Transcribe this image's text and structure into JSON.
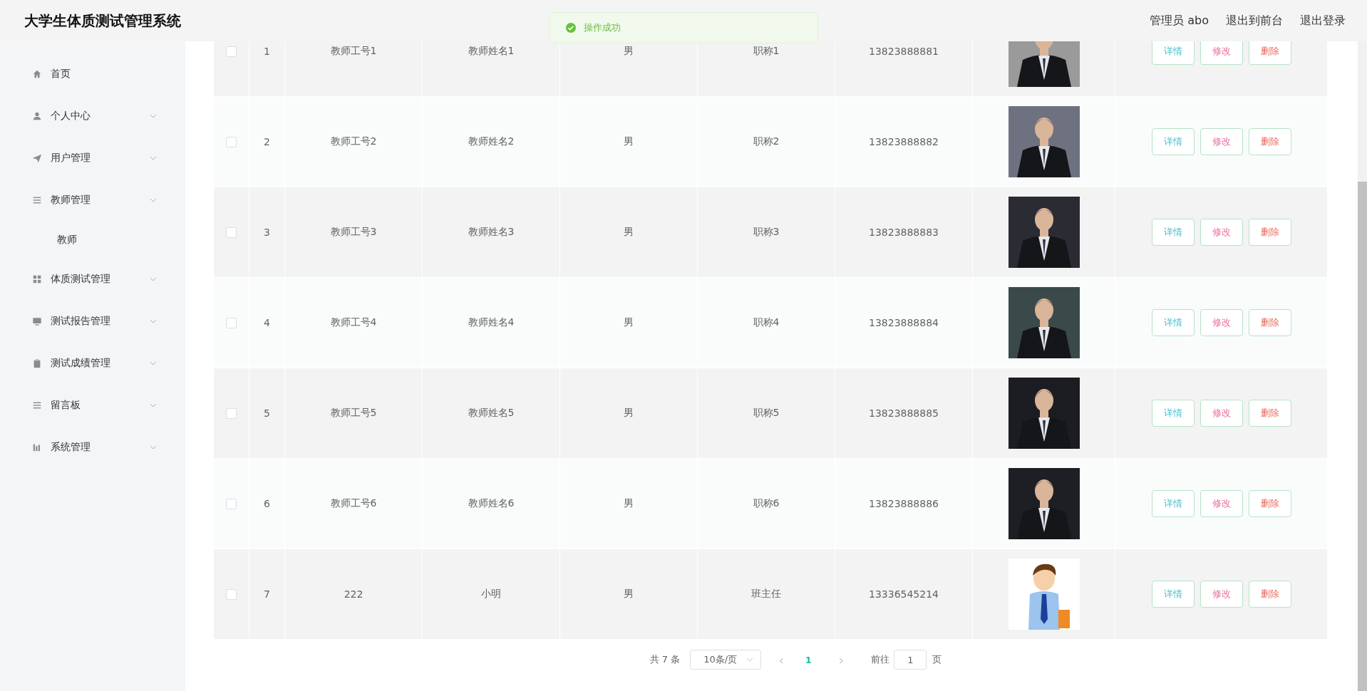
{
  "header": {
    "title": "大学生体质测试管理系统",
    "user": "管理员 abo",
    "links": [
      "退出到前台",
      "退出登录"
    ]
  },
  "toast": {
    "kind": "success",
    "message": "操作成功"
  },
  "sidebar": {
    "items": [
      {
        "label": "首页",
        "submenu": false
      },
      {
        "label": "个人中心",
        "submenu": true
      },
      {
        "label": "用户管理",
        "submenu": true
      },
      {
        "label": "教师管理",
        "submenu": true,
        "children": [
          {
            "label": "教师"
          }
        ]
      },
      {
        "label": "体质测试管理",
        "submenu": true
      },
      {
        "label": "测试报告管理",
        "submenu": true
      },
      {
        "label": "测试成绩管理",
        "submenu": true
      },
      {
        "label": "留言板",
        "submenu": true
      },
      {
        "label": "系统管理",
        "submenu": true
      }
    ]
  },
  "table": {
    "rows": [
      {
        "checked": false,
        "index": "1",
        "teacher_id": "教师工号1",
        "name": "教师姓名1",
        "gender": "男",
        "title": "职称1",
        "phone": "13823888881",
        "actions": [
          {
            "kind": "detail",
            "label": "详情"
          },
          {
            "kind": "edit",
            "label": "修改"
          },
          {
            "kind": "delete",
            "label": "删除"
          }
        ]
      },
      {
        "checked": false,
        "index": "2",
        "teacher_id": "教师工号2",
        "name": "教师姓名2",
        "gender": "男",
        "title": "职称2",
        "phone": "13823888882",
        "actions": [
          {
            "kind": "detail",
            "label": "详情"
          },
          {
            "kind": "edit",
            "label": "修改"
          },
          {
            "kind": "delete",
            "label": "删除"
          }
        ]
      },
      {
        "checked": false,
        "index": "3",
        "teacher_id": "教师工号3",
        "name": "教师姓名3",
        "gender": "男",
        "title": "职称3",
        "phone": "13823888883",
        "actions": [
          {
            "kind": "detail",
            "label": "详情"
          },
          {
            "kind": "edit",
            "label": "修改"
          },
          {
            "kind": "delete",
            "label": "删除"
          }
        ]
      },
      {
        "checked": false,
        "index": "4",
        "teacher_id": "教师工号4",
        "name": "教师姓名4",
        "gender": "男",
        "title": "职称4",
        "phone": "13823888884",
        "actions": [
          {
            "kind": "detail",
            "label": "详情"
          },
          {
            "kind": "edit",
            "label": "修改"
          },
          {
            "kind": "delete",
            "label": "删除"
          }
        ]
      },
      {
        "checked": false,
        "index": "5",
        "teacher_id": "教师工号5",
        "name": "教师姓名5",
        "gender": "男",
        "title": "职称5",
        "phone": "13823888885",
        "actions": [
          {
            "kind": "detail",
            "label": "详情"
          },
          {
            "kind": "edit",
            "label": "修改"
          },
          {
            "kind": "delete",
            "label": "删除"
          }
        ]
      },
      {
        "checked": false,
        "index": "6",
        "teacher_id": "教师工号6",
        "name": "教师姓名6",
        "gender": "男",
        "title": "职称6",
        "phone": "13823888886",
        "actions": [
          {
            "kind": "detail",
            "label": "详情"
          },
          {
            "kind": "edit",
            "label": "修改"
          },
          {
            "kind": "delete",
            "label": "删除"
          }
        ]
      },
      {
        "checked": false,
        "index": "7",
        "teacher_id": "222",
        "name": "小明",
        "gender": "男",
        "title": "班主任",
        "phone": "13336545214",
        "actions": [
          {
            "kind": "detail",
            "label": "详情"
          },
          {
            "kind": "edit",
            "label": "修改"
          },
          {
            "kind": "delete",
            "label": "删除"
          }
        ]
      }
    ]
  },
  "pagination": {
    "total": "共 7 条",
    "page_size": "10条/页",
    "prev": "‹",
    "pages": [
      {
        "label": "1",
        "selected": true
      }
    ],
    "next": "›",
    "goto_label": "前往",
    "goto_value": "1",
    "goto_suffix": "页"
  }
}
